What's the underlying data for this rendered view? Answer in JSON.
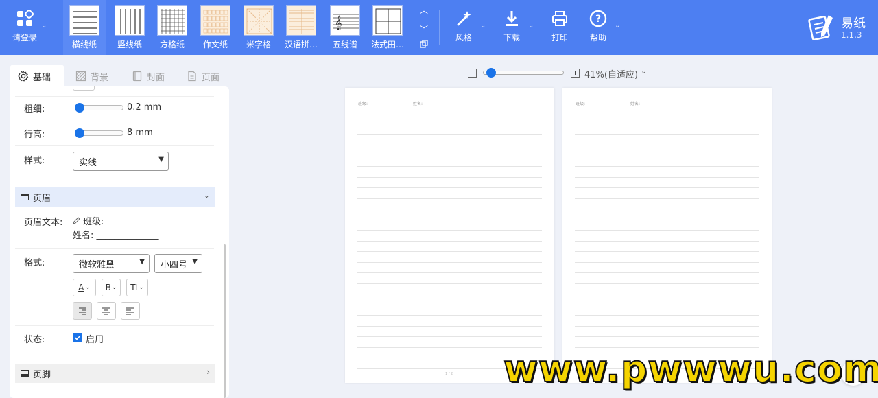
{
  "toolbar": {
    "login_label": "请登录",
    "paper_types": [
      {
        "label": "横线纸",
        "pattern": "horizontal",
        "active": true
      },
      {
        "label": "竖线纸",
        "pattern": "vertical"
      },
      {
        "label": "方格纸",
        "pattern": "grid"
      },
      {
        "label": "作文纸",
        "pattern": "composition"
      },
      {
        "label": "米字格",
        "pattern": "mizige"
      },
      {
        "label": "汉语拼…",
        "pattern": "pinyin"
      },
      {
        "label": "五线谱",
        "pattern": "staff"
      },
      {
        "label": "法式田…",
        "pattern": "french"
      }
    ],
    "style_label": "风格",
    "download_label": "下载",
    "print_label": "打印",
    "help_label": "帮助",
    "brand_name": "易纸",
    "version": "1.1.3",
    "accent_color": "#4d7ff2"
  },
  "panel": {
    "tabs": [
      "基础",
      "背景",
      "封面",
      "页面"
    ],
    "thickness_label": "粗细:",
    "thickness_value": "0.2 mm",
    "thickness_level": 0.05,
    "row_height_label": "行高:",
    "row_height_value": "8 mm",
    "row_height_level": 0.05,
    "style_label": "样式:",
    "style_value": "实线",
    "header_section": "页眉",
    "header_text_label": "页眉文本:",
    "header_text_line1": "班级: ______________",
    "header_text_line2": "姓名: ______________",
    "format_label": "格式:",
    "font_value": "微软雅黑",
    "size_value": "小四号",
    "font_color_btn": "A",
    "bold_btn": "B",
    "text_size_btn": "TI",
    "status_label": "状态:",
    "enabled_label": "启用",
    "enabled": true,
    "footer_section": "页脚"
  },
  "zoom": {
    "minus": "−",
    "plus": "+",
    "label": "41%(自适应)",
    "level": 0.1
  },
  "preview": {
    "class_label": "班级:",
    "name_label": "姓名:",
    "page_number": "1 / 2"
  },
  "watermark": "www.pwwwu.com"
}
